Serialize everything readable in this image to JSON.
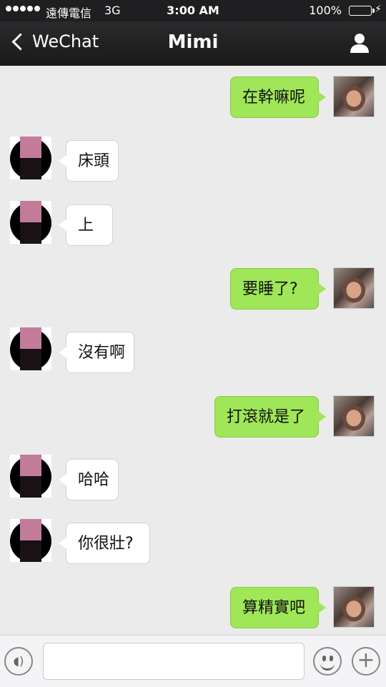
{
  "status_bar": {
    "carrier": "遠傳電信",
    "network": "3G",
    "time": "3:00 AM",
    "battery_percent": "100%",
    "battery_color": "#4cd964"
  },
  "nav": {
    "back_label": "WeChat",
    "title": "Mimi"
  },
  "messages": [
    {
      "side": "out",
      "text": "在幹嘛呢"
    },
    {
      "side": "in",
      "text": "床頭"
    },
    {
      "side": "in",
      "text": "上"
    },
    {
      "side": "out",
      "text": "要睡了?"
    },
    {
      "side": "in",
      "text": "沒有啊"
    },
    {
      "side": "out",
      "text": "打滾就是了"
    },
    {
      "side": "in",
      "text": "哈哈"
    },
    {
      "side": "in",
      "text": "你很壯?"
    },
    {
      "side": "out",
      "text": "算精實吧"
    }
  ],
  "input": {
    "value": "",
    "placeholder": ""
  },
  "icons": {
    "back": "chevron-left-icon",
    "profile": "profile-icon",
    "voice": "voice-icon",
    "emoji": "emoji-icon",
    "plus": "plus-icon"
  },
  "colors": {
    "outgoing_bubble": "#9fe658",
    "incoming_bubble": "#ffffff",
    "chat_background": "#ebebeb",
    "nav_background": "#1f1f21"
  }
}
